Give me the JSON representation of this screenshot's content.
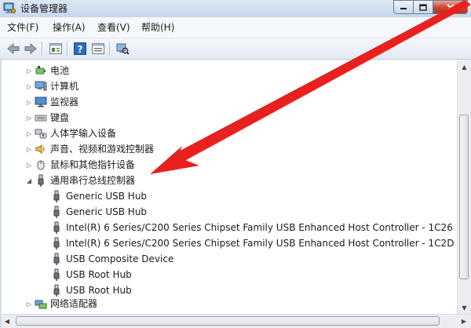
{
  "window": {
    "title": "设备管理器"
  },
  "menu": [
    {
      "label": "文件(F)"
    },
    {
      "label": "操作(A)"
    },
    {
      "label": "查看(V)"
    },
    {
      "label": "帮助(H)"
    }
  ],
  "toolbar": {
    "icons": [
      "back-icon",
      "forward-icon",
      "properties-icon",
      "help-icon",
      "show-hidden-icon",
      "scan-hardware-icon"
    ]
  },
  "tree": {
    "categories": [
      {
        "label": "电池",
        "icon": "battery-icon"
      },
      {
        "label": "计算机",
        "icon": "computer-icon"
      },
      {
        "label": "监视器",
        "icon": "monitor-icon"
      },
      {
        "label": "键盘",
        "icon": "keyboard-icon"
      },
      {
        "label": "人体学输入设备",
        "icon": "hid-icon"
      },
      {
        "label": "声音、视频和游戏控制器",
        "icon": "sound-icon"
      },
      {
        "label": "鼠标和其他指针设备",
        "icon": "mouse-icon"
      },
      {
        "label": "通用串行总线控制器",
        "icon": "usb-icon",
        "expanded": true
      }
    ],
    "usb_children": [
      {
        "label": "Generic USB Hub"
      },
      {
        "label": "Generic USB Hub"
      },
      {
        "label": "Intel(R) 6 Series/C200 Series Chipset Family USB Enhanced Host Controller - 1C26"
      },
      {
        "label": "Intel(R) 6 Series/C200 Series Chipset Family USB Enhanced Host Controller - 1C2D"
      },
      {
        "label": "USB Composite Device"
      },
      {
        "label": "USB Root Hub"
      },
      {
        "label": "USB Root Hub"
      }
    ],
    "after": [
      {
        "label": "网络适配器",
        "icon": "network-icon"
      }
    ]
  },
  "colors": {
    "arrow": "#e8211e",
    "accent": "#3a7fc4"
  }
}
